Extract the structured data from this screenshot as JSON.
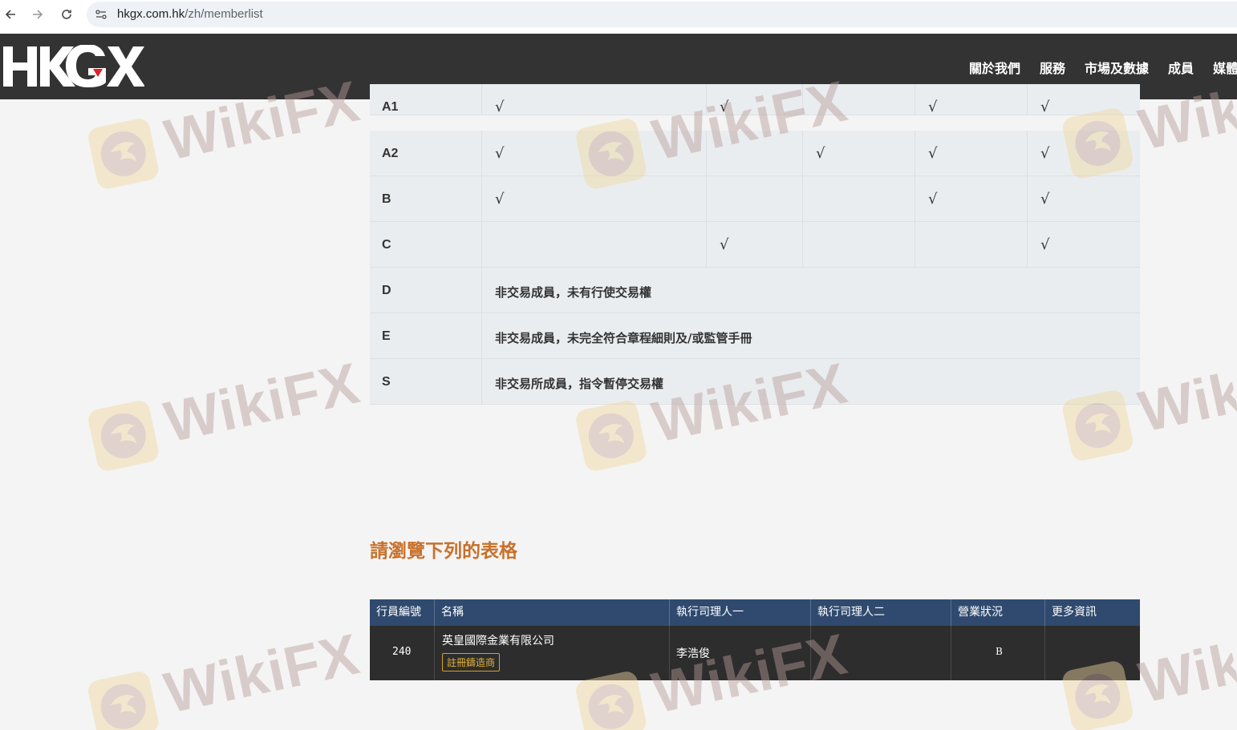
{
  "browser": {
    "url_host": "hkgx.com.hk",
    "url_path": "/zh/memberlist"
  },
  "header": {
    "logo_text": "HKGX",
    "nav": [
      "關於我們",
      "服務",
      "市場及數據",
      "成員",
      "媒體"
    ]
  },
  "legend": {
    "check_mark": "√",
    "rows": [
      {
        "code": "A1",
        "checks": [
          true,
          true,
          false,
          true,
          true
        ]
      },
      {
        "code": "A2",
        "checks": [
          true,
          false,
          true,
          true,
          true
        ]
      },
      {
        "code": "B",
        "checks": [
          true,
          false,
          false,
          true,
          true
        ]
      },
      {
        "code": "C",
        "checks": [
          false,
          true,
          false,
          false,
          true
        ]
      },
      {
        "code": "D",
        "desc": "非交易成員，未有行使交易權"
      },
      {
        "code": "E",
        "desc": "非交易成員，未完全符合章程細則及/或監管手冊"
      },
      {
        "code": "S",
        "desc": "非交易所成員，指令暫停交易權"
      }
    ]
  },
  "section": {
    "heading": "請瀏覽下列的表格"
  },
  "member_table": {
    "headers": [
      "行員編號",
      "名稱",
      "執行司理人一",
      "執行司理人二",
      "營業狀況",
      "更多資訊"
    ],
    "rows": [
      {
        "id": "240",
        "name": "英皇國際金業有限公司",
        "badge": "註冊鑄造商",
        "manager1": "李浩俊",
        "manager2": "",
        "status": "B",
        "more": ""
      }
    ]
  },
  "watermark": {
    "text": "WikiFX"
  },
  "colors": {
    "header_bg": "#333333",
    "accent_orange": "#c8702a",
    "table_head_bg": "#2f4a6e",
    "table_body_bg": "#2d2d2d",
    "badge_gold": "#d9a11e"
  }
}
